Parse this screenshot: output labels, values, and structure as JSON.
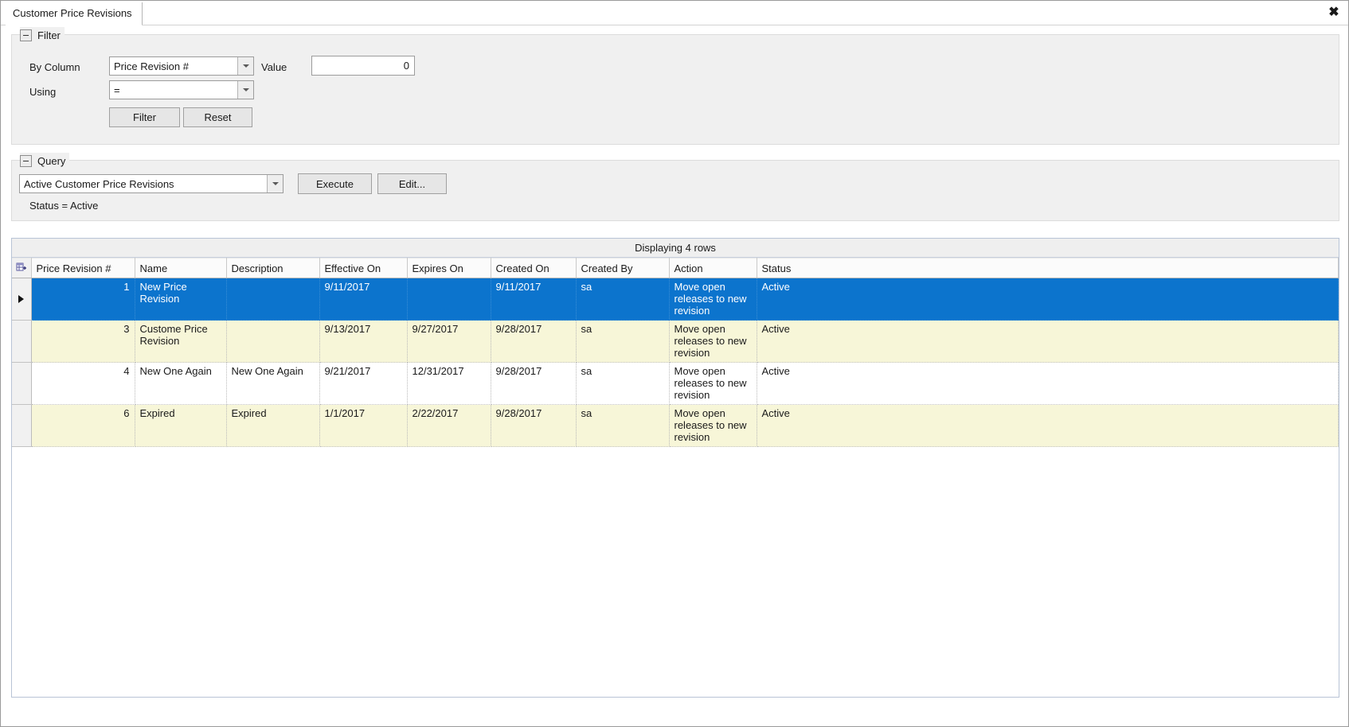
{
  "window": {
    "tab_label": "Customer Price Revisions",
    "close_icon": "close-icon",
    "close_glyph": "✖"
  },
  "filter": {
    "title": "Filter",
    "by_column_label": "By Column",
    "by_column_value": "Price Revision #",
    "value_label": "Value",
    "value_input": "0",
    "using_label": "Using",
    "using_value": "=",
    "filter_button": "Filter",
    "reset_button": "Reset"
  },
  "query": {
    "title": "Query",
    "selected_query": "Active Customer Price Revisions",
    "execute_button": "Execute",
    "edit_button": "Edit...",
    "status_line": "Status = Active"
  },
  "grid": {
    "caption": "Displaying 4 rows",
    "columns": [
      "Price Revision #",
      "Name",
      "Description",
      "Effective On",
      "Expires On",
      "Created On",
      "Created By",
      "Action",
      "Status"
    ],
    "rows": [
      {
        "revision": "1",
        "name": "New Price Revision",
        "description": "",
        "effective_on": "9/11/2017",
        "expires_on": "",
        "created_on": "9/11/2017",
        "created_by": "sa",
        "action": "Move open releases to new revision",
        "status": "Active",
        "selected": true
      },
      {
        "revision": "3",
        "name": "Custome Price Revision",
        "description": "",
        "effective_on": "9/13/2017",
        "expires_on": "9/27/2017",
        "created_on": "9/28/2017",
        "created_by": "sa",
        "action": "Move open releases to new revision",
        "status": "Active",
        "selected": false
      },
      {
        "revision": "4",
        "name": "New One Again",
        "description": "New One Again",
        "effective_on": "9/21/2017",
        "expires_on": "12/31/2017",
        "created_on": "9/28/2017",
        "created_by": "sa",
        "action": "Move open releases to new revision",
        "status": "Active",
        "selected": false
      },
      {
        "revision": "6",
        "name": "Expired",
        "description": "Expired",
        "effective_on": "1/1/2017",
        "expires_on": "2/22/2017",
        "created_on": "9/28/2017",
        "created_by": "sa",
        "action": "Move open releases to new revision",
        "status": "Active",
        "selected": false
      }
    ]
  },
  "colors": {
    "selection_blue": "#0c74cd",
    "alt_row_yellow": "#f7f6d8",
    "panel_gray": "#f0f0f0"
  }
}
